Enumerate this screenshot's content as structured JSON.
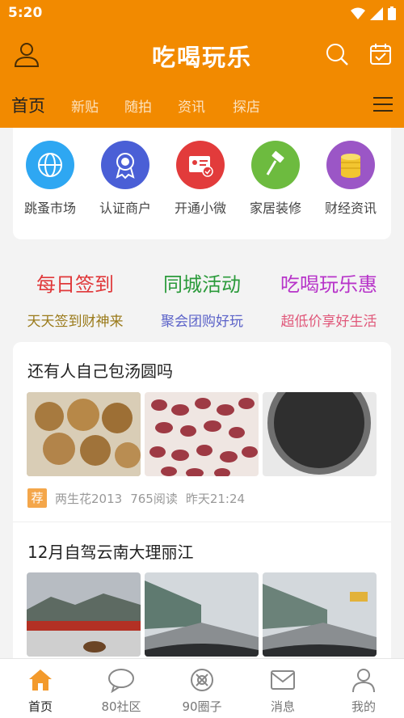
{
  "status": {
    "time": "5:20"
  },
  "header": {
    "title": "吃喝玩乐"
  },
  "tabs": [
    {
      "label": "首页",
      "active": true
    },
    {
      "label": "新贴"
    },
    {
      "label": "随拍"
    },
    {
      "label": "资讯"
    },
    {
      "label": "探店"
    }
  ],
  "categories": [
    {
      "label": "跳蚤市场",
      "icon": "globe-icon",
      "color": "#2ea7f2"
    },
    {
      "label": "认证商户",
      "icon": "badge-icon",
      "color": "#4a5fd6"
    },
    {
      "label": "开通小微",
      "icon": "id-card-icon",
      "color": "#e23b3b"
    },
    {
      "label": "家居装修",
      "icon": "hammer-icon",
      "color": "#6dbb3f"
    },
    {
      "label": "财经资讯",
      "icon": "coins-icon",
      "color": "#9b56c6"
    }
  ],
  "promos": [
    {
      "title": "每日签到",
      "subtitle": "天天签到财神来",
      "title_color": "#e0383a",
      "subtitle_color": "#9a7a1a"
    },
    {
      "title": "同城活动",
      "subtitle": "聚会团购好玩",
      "title_color": "#2a9a3a",
      "subtitle_color": "#5b62c8"
    },
    {
      "title": "吃喝玩乐惠",
      "subtitle": "超低价享好生活",
      "title_color": "#b733c9",
      "subtitle_color": "#e0587a"
    }
  ],
  "posts": [
    {
      "title": "还有人自己包汤圆吗",
      "tag": "荐",
      "author": "两生花2013",
      "views": "765阅读",
      "time": "昨天21:24",
      "images": [
        "walnuts-photo",
        "red-peanuts-photo",
        "black-sesame-photo"
      ]
    },
    {
      "title": "12月自驾云南大理丽江",
      "images": [
        "mountain-dog-photo",
        "highway-photo-1",
        "highway-photo-2"
      ]
    }
  ],
  "bottom_nav": [
    {
      "label": "首页",
      "icon": "home-icon",
      "active": true
    },
    {
      "label": "80社区",
      "icon": "chat-icon"
    },
    {
      "label": "90圈子",
      "icon": "circle-icon"
    },
    {
      "label": "消息",
      "icon": "mail-icon"
    },
    {
      "label": "我的",
      "icon": "person-icon"
    }
  ],
  "colors": {
    "brand": "#f28a00",
    "active_nav": "#f39a2c"
  }
}
